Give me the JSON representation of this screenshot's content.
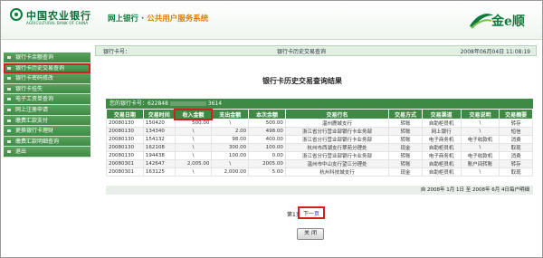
{
  "header": {
    "bank_name_cn": "中国农业银行",
    "bank_name_en": "AGRICULTURAL BANK OF CHINA",
    "system_part1": "网上银行",
    "system_sep": "·",
    "system_part2": "公共用户服务系统",
    "brand": "金e顺"
  },
  "breadcrumb": {
    "left": "银行卡号：",
    "center": "银行卡历史交易查询",
    "right": "2008年06月04日   11:08:19"
  },
  "sidebar": {
    "items": [
      {
        "label": "银行卡余额查询"
      },
      {
        "label": "银行卡历史交易查询"
      },
      {
        "label": "银行卡密码修改"
      },
      {
        "label": "银行卡挂失"
      },
      {
        "label": "电子工资单查询"
      },
      {
        "label": "网上注册申请"
      },
      {
        "label": "缴费汇款支付"
      },
      {
        "label": "更换银行卡理财"
      },
      {
        "label": "缴费汇款明细查询"
      },
      {
        "label": "退出"
      }
    ]
  },
  "main": {
    "title": "银行卡历史交易查询结果",
    "account_label": "您的银行卡号：622848",
    "account_suffix": "3614",
    "columns": [
      "交易日期",
      "交易时间",
      "收入金额",
      "支出金额",
      "本次余额",
      "交易行名",
      "交易方式",
      "交易渠道",
      "交易说明",
      "交易摘要"
    ],
    "rows": [
      [
        "20080130",
        "150420",
        "500.00",
        "\\",
        "500.00",
        "温州鹿城支行",
        "转账",
        "自助柜员机",
        "\\",
        "转存"
      ],
      [
        "20080130",
        "134340",
        "\\",
        "2.00",
        "498.00",
        "浙江省分行营业部银行卡业务部",
        "转账",
        "网上银行",
        "\\",
        "短信"
      ],
      [
        "20080130",
        "154132",
        "\\",
        "98.00",
        "400.00",
        "浙江省分行营业部银行卡业务部",
        "转账",
        "电子商务机",
        "电子收款机",
        "消费"
      ],
      [
        "20080130",
        "162108",
        "\\",
        "300.00",
        "100.00",
        "杭州市西湖支行翠苑分理处",
        "现金",
        "自助柜员机",
        "\\",
        "取现"
      ],
      [
        "20080130",
        "194438",
        "\\",
        "100.00",
        "0.00",
        "浙江省分行营业部银行卡业务部",
        "转账",
        "电子商务机",
        "电子收款机",
        "消费"
      ],
      [
        "20080301",
        "142647",
        "2,005.00",
        "\\",
        "2005.00",
        "温州市中山支行望江分理处",
        "转账",
        "自助柜员机",
        "账户间转账",
        "转存"
      ],
      [
        "20080301",
        "163125",
        "\\",
        "2,000.00",
        "5.00",
        "杭州科技城支行",
        "现金",
        "自助柜员机",
        "\\",
        "取现"
      ]
    ],
    "summary_left": "",
    "summary_right": "自 2008年 1月 1日 至 2008年 6月 4日每户明细",
    "page_label": "第1页",
    "next_label": "下一页",
    "close_label": "关 闭"
  }
}
